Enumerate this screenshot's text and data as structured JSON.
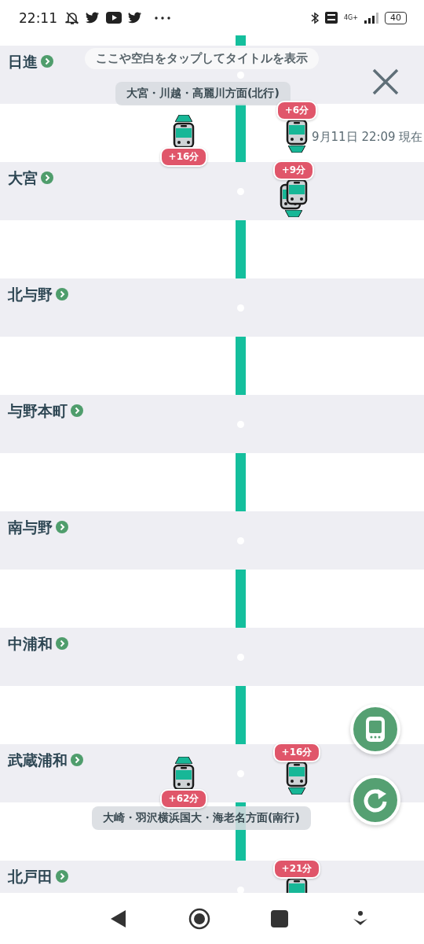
{
  "status_bar": {
    "time": "22:11",
    "network": "4G+",
    "battery": "40"
  },
  "hint": "ここや空白をタップしてタイトルを表示",
  "north_label": "大宮・川越・高麗川方面(北行)",
  "updated": "9月11日 22:09 現在",
  "south_label": "大崎・羽沢横浜国大・海老名方面(南行)",
  "stations": [
    {
      "name": "日進",
      "trains_after": [
        {
          "kind": "northbound",
          "stacked": false,
          "delay": "+16分"
        },
        {
          "kind": "southbound",
          "stacked": false,
          "delay": "+6分"
        }
      ]
    },
    {
      "name": "大宮",
      "trains": [
        {
          "kind": "southbound",
          "stacked": true,
          "delay": "+9分"
        }
      ]
    },
    {
      "name": "北与野"
    },
    {
      "name": "与野本町"
    },
    {
      "name": "南与野"
    },
    {
      "name": "中浦和"
    },
    {
      "name": "武蔵浦和",
      "trains": [
        {
          "kind": "northbound",
          "stacked": false,
          "delay": "+62分"
        },
        {
          "kind": "southbound",
          "stacked": false,
          "delay": "+16分"
        }
      ]
    },
    {
      "name": "北戸田",
      "trains": [
        {
          "kind": "southbound",
          "stacked": false,
          "delay": "+21分"
        }
      ]
    }
  ]
}
